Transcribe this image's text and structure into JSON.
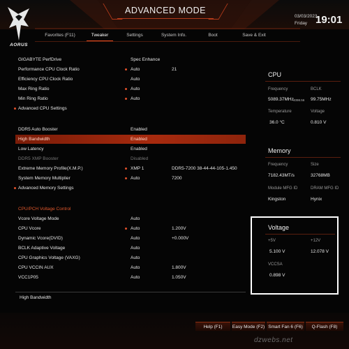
{
  "header": {
    "mode_title": "ADVANCED MODE",
    "brand": "AORUS",
    "date": "03/03/2023",
    "weekday": "Friday",
    "time": "19:01"
  },
  "tabs": [
    {
      "label": "Favorites (F11)",
      "active": false
    },
    {
      "label": "Tweaker",
      "active": true
    },
    {
      "label": "Settings",
      "active": false
    },
    {
      "label": "System Info.",
      "active": false
    },
    {
      "label": "Boot",
      "active": false
    },
    {
      "label": "Save & Exit",
      "active": false
    }
  ],
  "settings": [
    {
      "label": "GIGABYTE PerfDrive",
      "value": "Spec Enhance",
      "value2": "",
      "dot": false
    },
    {
      "label": "Performance CPU Clock Ratio",
      "value": "Auto",
      "value2": "21",
      "dot": true
    },
    {
      "label": "Efficiency CPU Clock Ratio",
      "value": "Auto",
      "value2": "",
      "dot": false
    },
    {
      "label": "Max Ring Ratio",
      "value": "Auto",
      "value2": "",
      "dot": true
    },
    {
      "label": "Min Ring Ratio",
      "value": "Auto",
      "value2": "",
      "dot": true
    },
    {
      "label": "Advanced CPU Settings",
      "value": "",
      "value2": "",
      "dot": false
    },
    {
      "label": "DDR5 Auto Booster",
      "value": "Enabled",
      "value2": "",
      "dot": false
    },
    {
      "label": "High Bandwidth",
      "value": "Enabled",
      "value2": "",
      "dot": false
    },
    {
      "label": "Low Latency",
      "value": "Enabled",
      "value2": "",
      "dot": false
    },
    {
      "label": "DDR5 XMP Booster",
      "value": "Disabled",
      "value2": "",
      "dot": false
    },
    {
      "label": "Extreme Memory Profile(X.M.P.)",
      "value": "XMP 1",
      "value2": "DDR5-7200 38-44-44-105-1.450",
      "dot": true
    },
    {
      "label": "System Memory Multiplier",
      "value": "Auto",
      "value2": "7200",
      "dot": true
    },
    {
      "label": "Advanced Memory Settings",
      "value": "",
      "value2": "",
      "dot": false
    },
    {
      "label": "CPU/PCH Voltage Control",
      "value": "",
      "value2": "",
      "dot": false
    },
    {
      "label": "Vcore Voltage Mode",
      "value": "Auto",
      "value2": "",
      "dot": false
    },
    {
      "label": "CPU Vcore",
      "value": "Auto",
      "value2": "1.200V",
      "dot": true
    },
    {
      "label": "Dynamic Vcore(DVID)",
      "value": "Auto",
      "value2": "+0.000V",
      "dot": false
    },
    {
      "label": "BCLK Adaptive Voltage",
      "value": "Auto",
      "value2": "",
      "dot": false
    },
    {
      "label": "CPU Graphics Voltage (VAXG)",
      "value": "Auto",
      "value2": "",
      "dot": false
    },
    {
      "label": "CPU VCCIN AUX",
      "value": "Auto",
      "value2": "1.800V",
      "dot": false
    },
    {
      "label": "VCC1P05",
      "value": "Auto",
      "value2": "1.050V",
      "dot": false
    }
  ],
  "cpu": {
    "title": "CPU",
    "frequency_label": "Frequency",
    "frequency_value": "5089.37MHz",
    "frequency_sub": "4098.56",
    "bclk_label": "BCLK",
    "bclk_value": "99.75MHz",
    "temp_label": "Temperature",
    "temp_value": "36.0 °C",
    "voltage_label": "Voltage",
    "voltage_value": "0.810 V"
  },
  "memory": {
    "title": "Memory",
    "frequency_label": "Frequency",
    "frequency_value": "7182.43MT/s",
    "size_label": "Size",
    "size_value": "32768MB",
    "module_label": "Module MFG ID",
    "module_value": "Kingston",
    "dram_label": "DRAM MFG ID",
    "dram_value": "Hynix"
  },
  "voltage": {
    "title": "Voltage",
    "v5_label": "+5V",
    "v5_value": "5.100 V",
    "v12_label": "+12V",
    "v12_value": "12.078 V",
    "vccsa_label": "VCCSA",
    "vccsa_value": "0.898 V"
  },
  "help_text": "High Bandwidth",
  "footer": {
    "help": "Help (F1)",
    "easy_mode": "Easy Mode (F2)",
    "smart_fan": "Smart Fan 6 (F6)",
    "qflash": "Q-Flash (F8)"
  },
  "watermark": "dzwebs.net",
  "colors": {
    "accent": "#e04a1e",
    "highlight_row": "#a72a0e",
    "section": "#e0582c"
  }
}
